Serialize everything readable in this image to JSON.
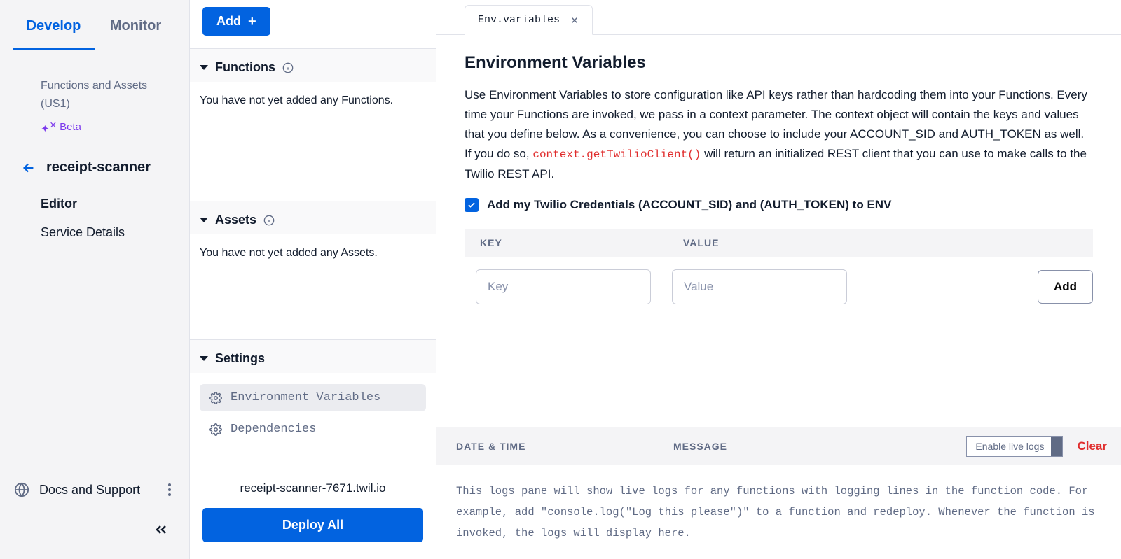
{
  "sidebar": {
    "tabs": [
      {
        "label": "Develop",
        "active": true
      },
      {
        "label": "Monitor",
        "active": false
      }
    ],
    "breadcrumb_line1": "Functions and Assets",
    "breadcrumb_line2": "(US1)",
    "beta_label": "Beta",
    "project_name": "receipt-scanner",
    "nav": [
      {
        "label": "Editor",
        "active": true
      },
      {
        "label": "Service Details",
        "active": false
      }
    ],
    "footer_label": "Docs and Support"
  },
  "middle": {
    "add_button": "Add",
    "sections": {
      "functions": {
        "title": "Functions",
        "empty_text": "You have not yet added any Functions."
      },
      "assets": {
        "title": "Assets",
        "empty_text": "You have not yet added any Assets."
      },
      "settings": {
        "title": "Settings",
        "items": [
          {
            "label": "Environment Variables",
            "active": true
          },
          {
            "label": "Dependencies",
            "active": false
          }
        ]
      }
    },
    "deploy_url": "receipt-scanner-7671.twil.io",
    "deploy_button": "Deploy All"
  },
  "main": {
    "tab": {
      "label": "Env.variables"
    },
    "heading": "Environment Variables",
    "description_pre": "Use Environment Variables to store configuration like API keys rather than hardcoding them into your Functions. Every time your Functions are invoked, we pass in a context parameter. The context object will contain the keys and values that you define below. As a convenience, you can choose to include your ACCOUNT_SID and AUTH_TOKEN as well. If you do so, ",
    "description_code": "context.getTwilioClient()",
    "description_post": " will return an initialized REST client that you can use to make calls to the Twilio REST API.",
    "checkbox_label": "Add my Twilio Credentials (ACCOUNT_SID) and (AUTH_TOKEN) to ENV",
    "checkbox_checked": true,
    "kv_headers": {
      "key": "KEY",
      "value": "VALUE"
    },
    "kv_placeholders": {
      "key": "Key",
      "value": "Value"
    },
    "add_kv_button": "Add"
  },
  "logs": {
    "headers": {
      "datetime": "DATE & TIME",
      "message": "MESSAGE"
    },
    "enable_label": "Enable live logs",
    "clear_label": "Clear",
    "placeholder_text": "This logs pane will show live logs for any functions with logging lines in the function code. For example, add \"console.log(\"Log this please\")\" to a function and redeploy. Whenever the function is invoked, the logs will display here."
  }
}
